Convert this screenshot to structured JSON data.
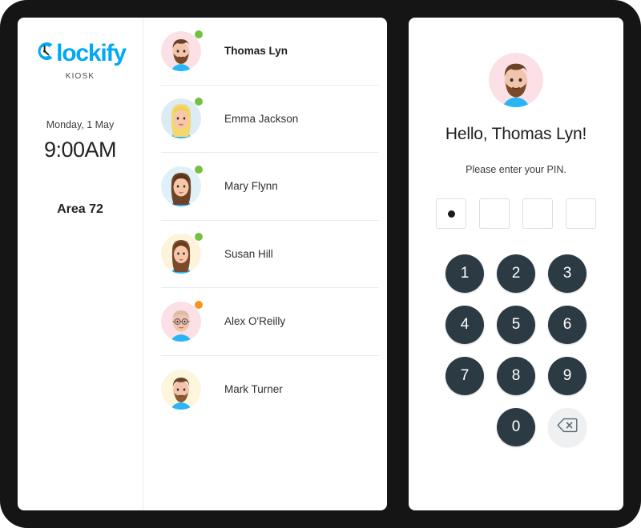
{
  "brand": {
    "logo_text": "lockify",
    "logo_icon": "clockify-c-icon",
    "subtitle": "KIOSK",
    "accent_color": "#03A9F4"
  },
  "info_panel": {
    "date": "Monday, 1 May",
    "time": "9:00AM",
    "area": "Area 72"
  },
  "user_list": {
    "users": [
      {
        "name": "Thomas Lyn",
        "status": "online",
        "selected": true,
        "avatar_bg": "#fbe0e6",
        "avatar_style": "man-brown-hair-beard"
      },
      {
        "name": "Emma Jackson",
        "status": "online",
        "selected": false,
        "avatar_bg": "#dcecf7",
        "avatar_style": "woman-blonde-long-hair"
      },
      {
        "name": "Mary Flynn",
        "status": "online",
        "selected": false,
        "avatar_bg": "#dff0f8",
        "avatar_style": "woman-brown-long-hair"
      },
      {
        "name": "Susan Hill",
        "status": "online",
        "selected": false,
        "avatar_bg": "#fdf3da",
        "avatar_style": "woman-auburn-hair"
      },
      {
        "name": "Alex O'Reilly",
        "status": "away",
        "selected": false,
        "avatar_bg": "#fbe0e6",
        "avatar_style": "man-bald-glasses"
      },
      {
        "name": "Mark Turner",
        "status": "none",
        "selected": false,
        "avatar_bg": "#fdf6dd",
        "avatar_style": "man-brown-hair-short-beard"
      }
    ],
    "status_colors": {
      "online": "#74C043",
      "away": "#F7941E"
    }
  },
  "pin_panel": {
    "greeting": "Hello, Thomas Lyn!",
    "prompt": "Please enter your PIN.",
    "avatar_style": "man-brown-hair-beard",
    "avatar_bg": "#fbe0e6",
    "pin_length": 4,
    "pin_filled": 1,
    "keypad": [
      "1",
      "2",
      "3",
      "4",
      "5",
      "6",
      "7",
      "8",
      "9",
      "0"
    ],
    "backspace_label": "backspace-icon",
    "key_color": "#2C3A43",
    "backspace_color": "#EEF0F1"
  }
}
